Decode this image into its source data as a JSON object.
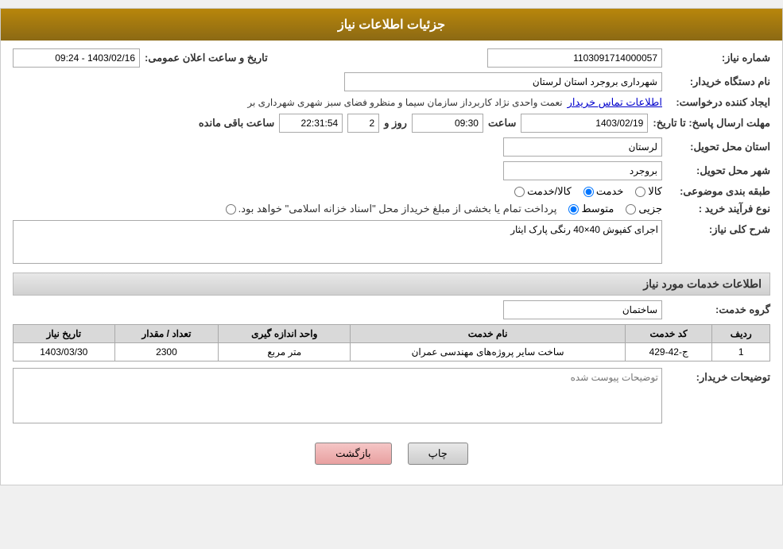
{
  "header": {
    "title": "جزئیات اطلاعات نیاز"
  },
  "fields": {
    "shomareNiaz_label": "شماره نیاز:",
    "shomareNiaz_value": "1103091714000057",
    "namDastgah_label": "نام دستگاه خریدار:",
    "namDastgah_value": "شهرداری بروجرد استان لرستان",
    "ejadKonande_label": "ایجاد کننده درخواست:",
    "ejadKonande_value": "نعمت واحدی نژاد کاربرداز سازمان سیما و منظرو فضای سبز شهری شهرداری بر",
    "ejadKonande_link": "اطلاعات تماس خریدار",
    "mohlat_label": "مهلت ارسال پاسخ: تا تاریخ:",
    "date_value": "1403/02/19",
    "time_label": "ساعت",
    "time_value": "09:30",
    "rooz_label": "روز و",
    "rooz_value": "2",
    "countdown_value": "22:31:54",
    "countdown_label": "ساعت باقی مانده",
    "ostan_label": "استان محل تحویل:",
    "ostan_value": "لرستان",
    "shahr_label": "شهر محل تحویل:",
    "shahr_value": "بروجرد",
    "tabaqebandi_label": "طبقه بندی موضوعی:",
    "tabaqebandi_options": [
      "کالا",
      "خدمت",
      "کالا/خدمت"
    ],
    "tabaqebandi_selected": "خدمت",
    "nowFarayand_label": "نوع فرآیند خرید :",
    "nowFarayand_options": [
      "جزیی",
      "متوسط",
      "پرداخت تمام یا بخشی از مبلغ خریداز محل \"اسناد خزانه اسلامی\" خواهد بود."
    ],
    "nowFarayand_selected": "متوسط",
    "sharh_label": "شرح کلی نیاز:",
    "sharh_value": "اجرای کفپوش 40×40 رنگی پارک ایثار",
    "info_section_title": "اطلاعات خدمات مورد نیاز",
    "grooh_label": "گروه خدمت:",
    "grooh_value": "ساختمان",
    "table": {
      "headers": [
        "ردیف",
        "کد خدمت",
        "نام خدمت",
        "واحد اندازه گیری",
        "تعداد / مقدار",
        "تاریخ نیاز"
      ],
      "rows": [
        {
          "radif": "1",
          "kod": "ج-42-429",
          "name": "ساخت سایر پروژه‌های مهندسی عمران",
          "vahed": "متر مربع",
          "tedad": "2300",
          "tarikh": "1403/03/30"
        }
      ]
    },
    "tozihat_label": "توضیحات خریدار:",
    "tozihat_placeholder": "توضیحات پیوست شده"
  },
  "buttons": {
    "print": "چاپ",
    "back": "بازگشت"
  },
  "tarikhAelan_label": "تاریخ و ساعت اعلان عمومی:",
  "tarikhAelan_value": "1403/02/16 - 09:24"
}
